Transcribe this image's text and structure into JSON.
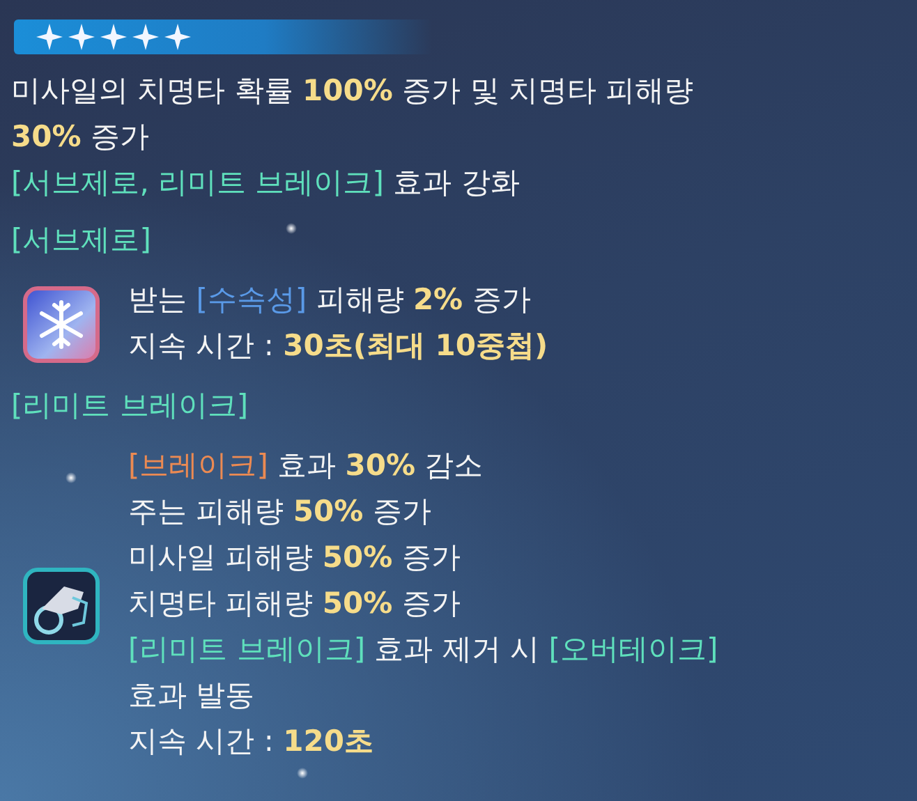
{
  "stars": 5,
  "description": [
    [
      {
        "kind": "plain",
        "t": "미사일의 치명타 확률 "
      },
      {
        "kind": "value",
        "t": "100%"
      },
      {
        "kind": "plain",
        "t": " 증가 및 치명타 피해량"
      }
    ],
    [
      {
        "kind": "value",
        "t": "30%"
      },
      {
        "kind": "plain",
        "t": " 증가"
      }
    ],
    [
      {
        "kind": "tag",
        "t": "[서브제로, 리미트 브레이크]"
      },
      {
        "kind": "plain",
        "t": " 효과 강화"
      }
    ]
  ],
  "sections": [
    {
      "title": "[서브제로]",
      "lines": [
        [
          {
            "kind": "plain",
            "t": "받는 "
          },
          {
            "kind": "element",
            "t": "[수속성]"
          },
          {
            "kind": "plain",
            "t": " 피해량 "
          },
          {
            "kind": "value",
            "t": "2%"
          },
          {
            "kind": "plain",
            "t": " 증가"
          }
        ],
        [
          {
            "kind": "plain",
            "t": "지속 시간 : "
          },
          {
            "kind": "value",
            "t": "30초(최대 10중첩)"
          }
        ]
      ]
    },
    {
      "title": "[리미트 브레이크]",
      "lines": [
        [
          {
            "kind": "warn",
            "t": "[브레이크]"
          },
          {
            "kind": "plain",
            "t": " 효과 "
          },
          {
            "kind": "value",
            "t": "30%"
          },
          {
            "kind": "plain",
            "t": " 감소"
          }
        ],
        [
          {
            "kind": "plain",
            "t": "주는 피해량 "
          },
          {
            "kind": "value",
            "t": "50%"
          },
          {
            "kind": "plain",
            "t": " 증가"
          }
        ],
        [
          {
            "kind": "plain",
            "t": "미사일 피해량 "
          },
          {
            "kind": "value",
            "t": "50%"
          },
          {
            "kind": "plain",
            "t": " 증가"
          }
        ],
        [
          {
            "kind": "plain",
            "t": "치명타 피해량 "
          },
          {
            "kind": "value",
            "t": "50%"
          },
          {
            "kind": "plain",
            "t": " 증가"
          }
        ],
        [
          {
            "kind": "tag",
            "t": "[리미트 브레이크]"
          },
          {
            "kind": "plain",
            "t": " 효과 제거 시 "
          },
          {
            "kind": "tag",
            "t": "[오버테이크]"
          }
        ],
        [
          {
            "kind": "plain",
            "t": "효과 발동"
          }
        ],
        [
          {
            "kind": "plain",
            "t": "지속 시간 : "
          },
          {
            "kind": "value",
            "t": "120초"
          }
        ]
      ]
    }
  ]
}
